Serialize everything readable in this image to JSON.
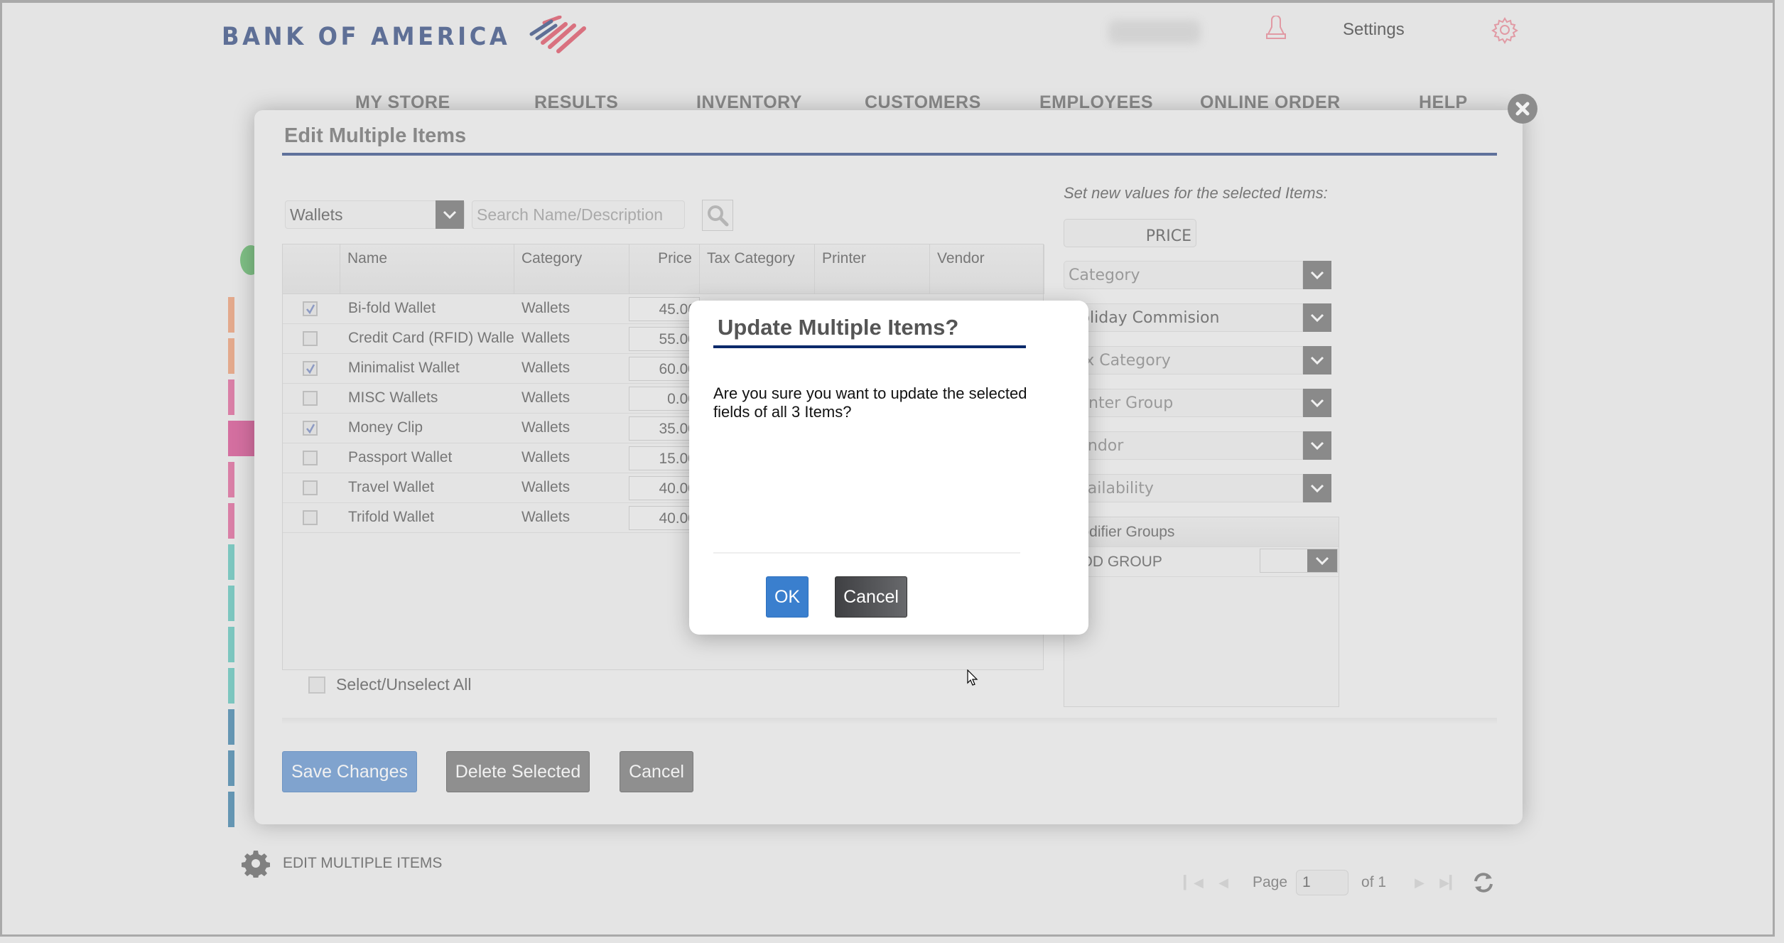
{
  "header": {
    "logo_text": "BANK OF AMERICA",
    "settings_label": "Settings",
    "nav": [
      "MY STORE",
      "RESULTS",
      "INVENTORY",
      "CUSTOMERS",
      "EMPLOYEES",
      "ONLINE ORDER",
      "HELP"
    ]
  },
  "edit_modal": {
    "title": "Edit Multiple Items",
    "category_filter": "Wallets",
    "search_placeholder": "Search Name/Description",
    "columns": [
      "Name",
      "Category",
      "Price",
      "Tax Category",
      "Printer",
      "Vendor"
    ],
    "rows": [
      {
        "checked": true,
        "name": "Bi-fold Wallet",
        "category": "Wallets",
        "price": "45.00"
      },
      {
        "checked": false,
        "name": "Credit Card (RFID) Wallet",
        "category": "Wallets",
        "price": "55.00"
      },
      {
        "checked": true,
        "name": "Minimalist Wallet",
        "category": "Wallets",
        "price": "60.00"
      },
      {
        "checked": false,
        "name": "MISC Wallets",
        "category": "Wallets",
        "price": "0.00"
      },
      {
        "checked": true,
        "name": "Money Clip",
        "category": "Wallets",
        "price": "35.00"
      },
      {
        "checked": false,
        "name": "Passport Wallet",
        "category": "Wallets",
        "price": "15.00"
      },
      {
        "checked": false,
        "name": "Travel Wallet",
        "category": "Wallets",
        "price": "40.00"
      },
      {
        "checked": false,
        "name": "Trifold Wallet",
        "category": "Wallets",
        "price": "40.00"
      }
    ],
    "select_all_label": "Select/Unselect All",
    "buttons": {
      "save": "Save Changes",
      "delete": "Delete Selected",
      "cancel": "Cancel"
    },
    "right_panel": {
      "label": "Set new values for the selected Items:",
      "price_placeholder": "PRICE",
      "selects": [
        {
          "value": "Category",
          "is_placeholder": true
        },
        {
          "value": "Holiday Commision",
          "is_placeholder": false
        },
        {
          "value": "Tax Category",
          "is_placeholder": true
        },
        {
          "value": "Printer Group",
          "is_placeholder": true
        },
        {
          "value": "Vendor",
          "is_placeholder": true
        },
        {
          "value": "Availability",
          "is_placeholder": true
        }
      ],
      "modifier_groups_header": "Modifier Groups",
      "modifier_rows": [
        {
          "name": "MOD GROUP",
          "value": ""
        }
      ]
    }
  },
  "confirm_dialog": {
    "title": "Update Multiple Items?",
    "message": "Are you sure you want to update the selected fields of all 3 Items?",
    "ok_label": "OK",
    "cancel_label": "Cancel"
  },
  "footer": {
    "section_title": "EDIT MULTIPLE ITEMS",
    "page_label": "Page",
    "page_value": "1",
    "of_label": "of 1"
  },
  "colors": {
    "brand_blue": "#5e6f96",
    "brand_red": "#d9717f",
    "ok_blue": "#3a7fce",
    "dialog_rule": "#0b2a6b",
    "stripes": [
      "#e3a98c",
      "#e3a98c",
      "#d97fa6",
      "#d46fa0",
      "#d97fa6",
      "#d97fa6",
      "#7cc6bf",
      "#7cc6bf",
      "#7cc6bf",
      "#7cc6bf",
      "#6596b3",
      "#6596b3",
      "#6596b3"
    ]
  }
}
